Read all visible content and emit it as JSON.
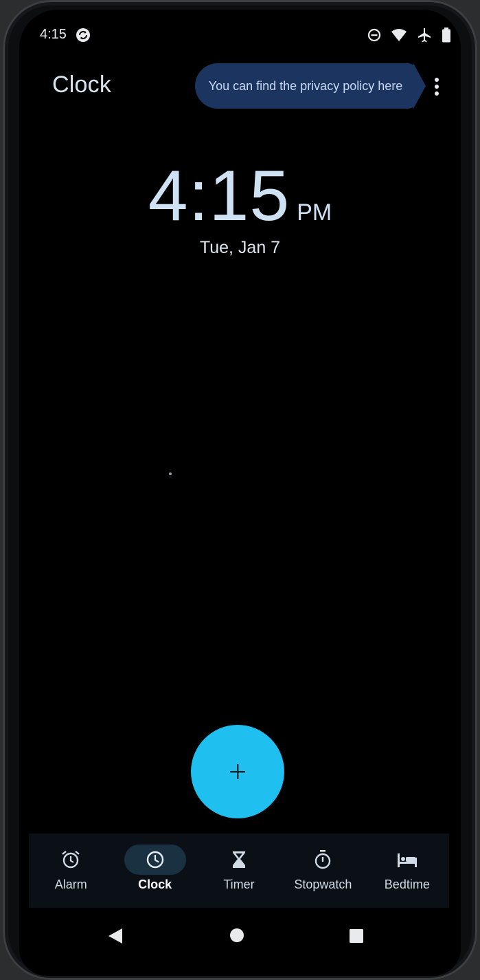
{
  "status_bar": {
    "time": "4:15",
    "icons": [
      "sync-icon",
      "do-not-disturb-icon",
      "wifi-icon",
      "airplane-mode-icon",
      "battery-icon"
    ]
  },
  "top_bar": {
    "title": "Clock",
    "tooltip": "You can find the privacy policy here",
    "more_icon": "more-vert-icon"
  },
  "clock": {
    "time": "4:15",
    "ampm": "PM",
    "date": "Tue, Jan 7"
  },
  "fab": {
    "icon": "plus-icon",
    "symbol": "+",
    "color": "#1fbff0"
  },
  "bottom_nav": {
    "items": [
      {
        "label": "Alarm",
        "icon": "alarm-icon",
        "active": false
      },
      {
        "label": "Clock",
        "icon": "clock-icon",
        "active": true
      },
      {
        "label": "Timer",
        "icon": "hourglass-icon",
        "active": false
      },
      {
        "label": "Stopwatch",
        "icon": "stopwatch-icon",
        "active": false
      },
      {
        "label": "Bedtime",
        "icon": "bed-icon",
        "active": false
      }
    ]
  },
  "system_nav": {
    "icons": [
      "back-icon",
      "home-icon",
      "recents-icon"
    ]
  },
  "colors": {
    "background": "#000000",
    "accent": "#1fbff0",
    "tooltip_bg": "#1c3460",
    "active_pill": "#1a3142"
  }
}
